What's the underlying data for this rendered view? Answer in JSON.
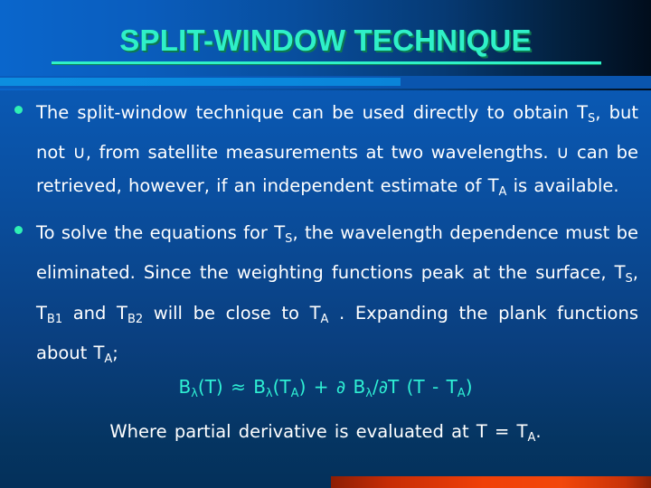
{
  "slide": {
    "title": "SPLIT-WINDOW TECHNIQUE",
    "colors": {
      "title": "#2ff0c8",
      "title_shadow": "#0c7a52",
      "body_text": "#ffffff",
      "bullet": "#2ff0b4",
      "formula": "#2ff0d4",
      "accent_bar_bright": "#0c8ee0",
      "accent_bar_dark": "#0a55ae",
      "red_accent": "#f04008",
      "background_top_left": "#0a66cc",
      "background_top_right": "#010d1c",
      "background_bottom": "#04305a"
    },
    "bullets": [
      {
        "segments": [
          {
            "type": "text",
            "value": "The split-window technique can be used directly to obtain T"
          },
          {
            "type": "sub",
            "value": "S"
          },
          {
            "type": "text",
            "value": ", but not ∪, from satellite measurements at two wavelengths. ∪ can be retrieved, however, if an independent estimate of T"
          },
          {
            "type": "sub",
            "value": "A"
          },
          {
            "type": "text",
            "value": " is available."
          }
        ]
      },
      {
        "segments": [
          {
            "type": "text",
            "value": "To solve the equations for T"
          },
          {
            "type": "sub",
            "value": "S"
          },
          {
            "type": "text",
            "value": ", the wavelength dependence must be eliminated. Since the weighting functions peak at the surface, T"
          },
          {
            "type": "sub",
            "value": "S"
          },
          {
            "type": "text",
            "value": ", T"
          },
          {
            "type": "sub",
            "value": "B1"
          },
          {
            "type": "text",
            "value": " and T"
          },
          {
            "type": "sub",
            "value": "B2"
          },
          {
            "type": "text",
            "value": " will be close to T"
          },
          {
            "type": "sub",
            "value": "A"
          },
          {
            "type": "text",
            "value": " . Expanding the plank functions about T"
          },
          {
            "type": "sub",
            "value": "A"
          },
          {
            "type": "text",
            "value": ";"
          }
        ]
      }
    ],
    "formula": {
      "segments": [
        {
          "type": "text",
          "value": "B"
        },
        {
          "type": "sub",
          "value": "λ"
        },
        {
          "type": "text",
          "value": "(T) ≈ B"
        },
        {
          "type": "sub",
          "value": "λ"
        },
        {
          "type": "text",
          "value": "(T"
        },
        {
          "type": "sub",
          "value": "A"
        },
        {
          "type": "text",
          "value": ") + ∂ B"
        },
        {
          "type": "sub",
          "value": "λ"
        },
        {
          "type": "text",
          "value": "/∂T (T - T"
        },
        {
          "type": "sub",
          "value": "A"
        },
        {
          "type": "text",
          "value": ")"
        }
      ]
    },
    "closing": {
      "segments": [
        {
          "type": "text",
          "value": "Where partial derivative is evaluated at T = T"
        },
        {
          "type": "sub",
          "value": "A"
        },
        {
          "type": "text",
          "value": "."
        }
      ]
    }
  }
}
